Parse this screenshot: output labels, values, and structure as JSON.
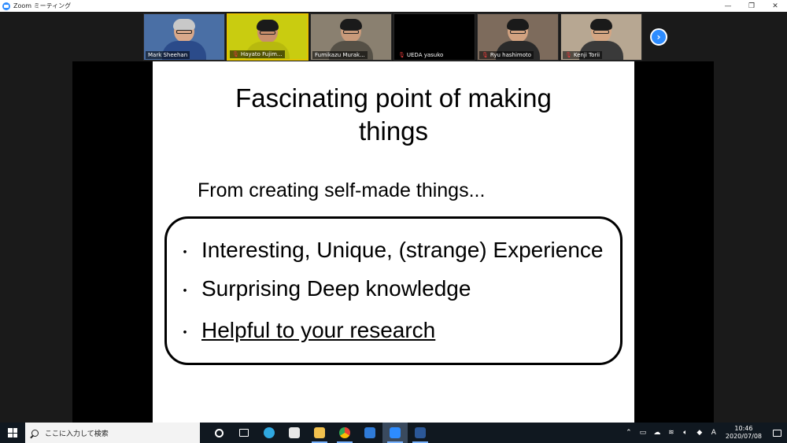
{
  "window": {
    "title": "Zoom ミーティング",
    "controls": {
      "minimize": "—",
      "restore": "❐",
      "close": "✕"
    }
  },
  "participants": [
    {
      "name": "Mark Sheehan",
      "muted": false,
      "bg": "#4a6fa5",
      "skin": "#d9a88a",
      "hair": "#c8c8c8",
      "shirt": "#2b4b8a"
    },
    {
      "name": "Hayato Fujim...",
      "muted": true,
      "active": true,
      "bg": "#c9cc10",
      "skin": "#c98f6c",
      "hair": "#1a1a1a",
      "shirt": "#b7b90e"
    },
    {
      "name": "Fumikazu Murak...",
      "muted": false,
      "bg": "#8a8070",
      "skin": "#c99a7a",
      "hair": "#1a1a1a",
      "shirt": "#555046"
    },
    {
      "name": "UEDA yasuko",
      "muted": true,
      "video_off": true,
      "bg": "#000000"
    },
    {
      "name": "Ryu hashimoto",
      "muted": true,
      "bg": "#7d6b5c",
      "skin": "#d2a280",
      "hair": "#1a1a1a",
      "shirt": "#2a2a2a"
    },
    {
      "name": "Kenji Torii",
      "muted": true,
      "bg": "#b7a792",
      "skin": "#d4a582",
      "hair": "#1a1a1a",
      "shirt": "#3a3a3a"
    }
  ],
  "gallery_next_icon": "chevron-right-icon",
  "slide": {
    "title_line1": "Fascinating point of making",
    "title_line2": "things",
    "subtitle": "From creating self-made things...",
    "bullet_glyph": "・",
    "bullets": [
      "Interesting, Unique, (strange) Experience",
      "Surprising Deep knowledge",
      "Helpful to your research"
    ]
  },
  "taskbar": {
    "search_placeholder": "ここに入力して検索",
    "apps": [
      {
        "name": "cortana-icon",
        "color": "#ffffff"
      },
      {
        "name": "task-view-icon",
        "color": "#ffffff"
      },
      {
        "name": "edge-icon",
        "color": "#2fa8e0"
      },
      {
        "name": "store-icon",
        "color": "#e8e8e8"
      },
      {
        "name": "file-explorer-icon",
        "color": "#f2c14e"
      },
      {
        "name": "chrome-icon",
        "color": "#e94235"
      },
      {
        "name": "mail-icon",
        "color": "#2f7bd8"
      },
      {
        "name": "zoom-icon",
        "color": "#2d8cff"
      },
      {
        "name": "word-icon",
        "color": "#2b5797"
      }
    ],
    "tray": {
      "ime": "A",
      "time": "10:46",
      "date": "2020/07/08"
    }
  }
}
